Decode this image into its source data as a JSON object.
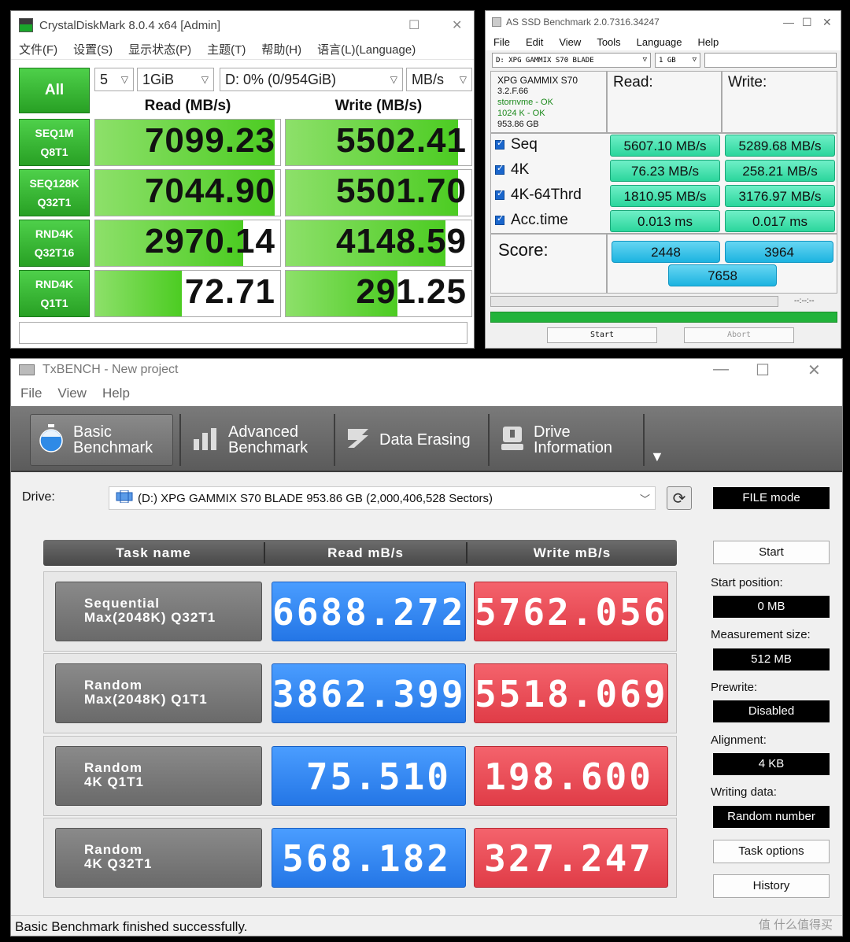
{
  "cdm": {
    "title": "CrystalDiskMark 8.0.4 x64 [Admin]",
    "menu": [
      "文件(F)",
      "设置(S)",
      "显示状态(P)",
      "主题(T)",
      "帮助(H)",
      "语言(L)(Language)"
    ],
    "all_label": "All",
    "count": "5",
    "size": "1GiB",
    "drive": "D: 0% (0/954GiB)",
    "unit": "MB/s",
    "read_header": "Read (MB/s)",
    "write_header": "Write (MB/s)",
    "rows": [
      {
        "l1": "SEQ1M",
        "l2": "Q8T1",
        "read": "7099.23",
        "write": "5502.41",
        "read_frac": 0.97,
        "write_frac": 0.93
      },
      {
        "l1": "SEQ128K",
        "l2": "Q32T1",
        "read": "7044.90",
        "write": "5501.70",
        "read_frac": 0.97,
        "write_frac": 0.93
      },
      {
        "l1": "RND4K",
        "l2": "Q32T16",
        "read": "2970.14",
        "write": "4148.59",
        "read_frac": 0.8,
        "write_frac": 0.86
      },
      {
        "l1": "RND4K",
        "l2": "Q1T1",
        "read": "72.71",
        "write": "291.25",
        "read_frac": 0.47,
        "write_frac": 0.6
      }
    ]
  },
  "asssd": {
    "title": "AS SSD Benchmark 2.0.7316.34247",
    "menu": [
      "File",
      "Edit",
      "View",
      "Tools",
      "Language",
      "Help"
    ],
    "drive_select": "D: XPG GAMMIX S70 BLADE",
    "size_select": "1 GB",
    "info": {
      "name": "XPG GAMMIX S70",
      "fw": "3.2.F.66",
      "driver": "stornvme - OK",
      "align": "1024 K - OK",
      "capacity": "953.86 GB"
    },
    "read_header": "Read:",
    "write_header": "Write:",
    "rows": [
      {
        "label": "Seq",
        "read": "5607.10 MB/s",
        "write": "5289.68 MB/s"
      },
      {
        "label": "4K",
        "read": "76.23 MB/s",
        "write": "258.21 MB/s"
      },
      {
        "label": "4K-64Thrd",
        "read": "1810.95 MB/s",
        "write": "3176.97 MB/s"
      },
      {
        "label": "Acc.time",
        "read": "0.013 ms",
        "write": "0.017 ms"
      }
    ],
    "score_label": "Score:",
    "score_read": "2448",
    "score_write": "3964",
    "score_total": "7658",
    "time": "--:--:--",
    "start": "Start",
    "abort": "Abort",
    "colors": {
      "value_box": "#2bd69c",
      "score_box": "#1cb3e0",
      "progress": "#21b33a"
    }
  },
  "tx": {
    "title": "TxBENCH - New project",
    "menu": [
      "File",
      "View",
      "Help"
    ],
    "tabs": [
      {
        "l1": "Basic",
        "l2": "Benchmark"
      },
      {
        "l1": "Advanced",
        "l2": "Benchmark"
      },
      {
        "l1": "Data Erasing",
        "l2": ""
      },
      {
        "l1": "Drive",
        "l2": "Information"
      }
    ],
    "drive_label": "Drive:",
    "drive_value": "(D:) XPG GAMMIX S70 BLADE  953.86 GB (2,000,406,528 Sectors)",
    "mode": "FILE mode",
    "headers": {
      "task": "Task name",
      "read": "Read mB/s",
      "write": "Write mB/s"
    },
    "rows": [
      {
        "l1": "Sequential",
        "l2": "Max(2048K) Q32T1",
        "read": "6688.272",
        "write": "5762.056"
      },
      {
        "l1": "Random",
        "l2": "Max(2048K) Q1T1",
        "read": "3862.399",
        "write": "5518.069"
      },
      {
        "l1": "Random",
        "l2": "4K Q1T1",
        "read": "75.510",
        "write": "198.600"
      },
      {
        "l1": "Random",
        "l2": "4K Q32T1",
        "read": "568.182",
        "write": "327.247"
      }
    ],
    "start": "Start",
    "start_position_label": "Start position:",
    "start_position": "0 MB",
    "measurement_label": "Measurement size:",
    "measurement": "512 MB",
    "prewrite_label": "Prewrite:",
    "prewrite": "Disabled",
    "alignment_label": "Alignment:",
    "alignment": "4 KB",
    "writing_label": "Writing data:",
    "writing": "Random number",
    "task_options": "Task options",
    "history": "History",
    "status": "Basic Benchmark finished successfully.",
    "watermark": "值 什么值得买",
    "colors": {
      "read": "#2476e6",
      "write": "#e03c47"
    }
  }
}
